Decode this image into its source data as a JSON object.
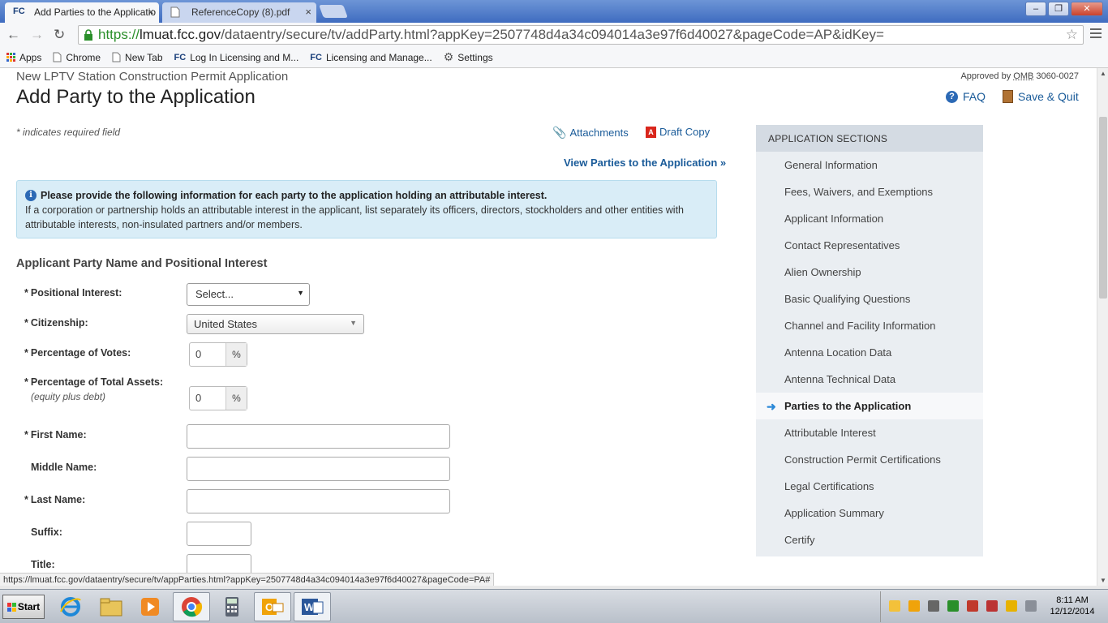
{
  "browser": {
    "tabs": [
      {
        "favicon": "FC",
        "title": "Add Parties to the Applicatio",
        "close": "×"
      },
      {
        "title": "ReferenceCopy (8).pdf",
        "close": "×"
      }
    ],
    "window_buttons": {
      "minimize": "‒",
      "restore": "❐",
      "close": "✕"
    },
    "address": {
      "scheme": "https://",
      "host": "lmuat.fcc.gov",
      "path": "/dataentry/secure/tv/addParty.html?appKey=2507748d4a34c094014a3e97f6d40027&pageCode=AP&idKey="
    },
    "bookmarks": [
      {
        "label": "Apps",
        "icon": "apps-grid-icon"
      },
      {
        "label": "Chrome",
        "icon": "page-icon"
      },
      {
        "label": "New Tab",
        "icon": "page-icon"
      },
      {
        "label": "Log In Licensing and M...",
        "icon": "fcc-icon",
        "favicon": "FC"
      },
      {
        "label": "Licensing and Manage...",
        "icon": "fcc-icon",
        "favicon": "FC"
      },
      {
        "label": "Settings",
        "icon": "gear-icon"
      }
    ],
    "status_url": "https://lmuat.fcc.gov/dataentry/secure/tv/appParties.html?appKey=2507748d4a34c094014a3e97f6d40027&pageCode=PA#"
  },
  "header": {
    "subtitle": "New LPTV Station Construction Permit Application",
    "title": "Add Party to the Application",
    "omb_prefix": "Approved by",
    "omb_abbr": "OMB",
    "omb_number": "3060-0027",
    "faq": "FAQ",
    "save_quit": "Save & Quit"
  },
  "toolbar": {
    "required_note": "* indicates required field",
    "attachments": "Attachments",
    "draft_copy": "Draft Copy",
    "view_parties": "View Parties to the Application »"
  },
  "info": {
    "heading": "Please provide the following information for each party to the application holding an attributable interest.",
    "body": "If a corporation or partnership holds an attributable interest in the applicant, list separately its officers, directors, stockholders and other entities with attributable interests, non-insulated partners and/or members."
  },
  "form": {
    "section_title": "Applicant Party Name and Positional Interest",
    "required_mark": "*",
    "positional_interest": {
      "label": "Positional Interest:",
      "value": "Select..."
    },
    "citizenship": {
      "label": "Citizenship:",
      "value": "United States"
    },
    "votes": {
      "label": "Percentage of Votes:",
      "value": "0",
      "unit": "%"
    },
    "assets": {
      "label": "Percentage of Total Assets:",
      "sublabel": "(equity plus debt)",
      "value": "0",
      "unit": "%"
    },
    "first_name": {
      "label": "First Name:"
    },
    "middle_name": {
      "label": "Middle Name:"
    },
    "last_name": {
      "label": "Last Name:"
    },
    "suffix": {
      "label": "Suffix:"
    },
    "title_field": {
      "label": "Title:"
    }
  },
  "sidebar": {
    "heading": "APPLICATION SECTIONS",
    "items": [
      {
        "label": "General Information"
      },
      {
        "label": "Fees, Waivers, and Exemptions"
      },
      {
        "label": "Applicant Information"
      },
      {
        "label": "Contact Representatives"
      },
      {
        "label": "Alien Ownership"
      },
      {
        "label": "Basic Qualifying Questions"
      },
      {
        "label": "Channel and Facility Information"
      },
      {
        "label": "Antenna Location Data"
      },
      {
        "label": "Antenna Technical Data"
      },
      {
        "label": "Parties to the Application",
        "active": true
      },
      {
        "label": "Attributable Interest"
      },
      {
        "label": "Construction Permit Certifications"
      },
      {
        "label": "Legal Certifications"
      },
      {
        "label": "Application Summary"
      },
      {
        "label": "Certify"
      }
    ]
  },
  "taskbar": {
    "start": "Start",
    "apps": [
      "internet-explorer-icon",
      "file-explorer-icon",
      "media-player-icon",
      "chrome-icon",
      "calculator-icon",
      "outlook-icon",
      "word-icon"
    ],
    "app_letters": {
      "outlook": "O",
      "word": "W"
    },
    "time": "8:11 AM",
    "date": "12/12/2014"
  },
  "colors": {
    "link": "#1a5b99",
    "info_bg": "#d9edf7",
    "sidebar_bg": "#eaeef2",
    "sidebar_head": "#d4dbe3"
  }
}
